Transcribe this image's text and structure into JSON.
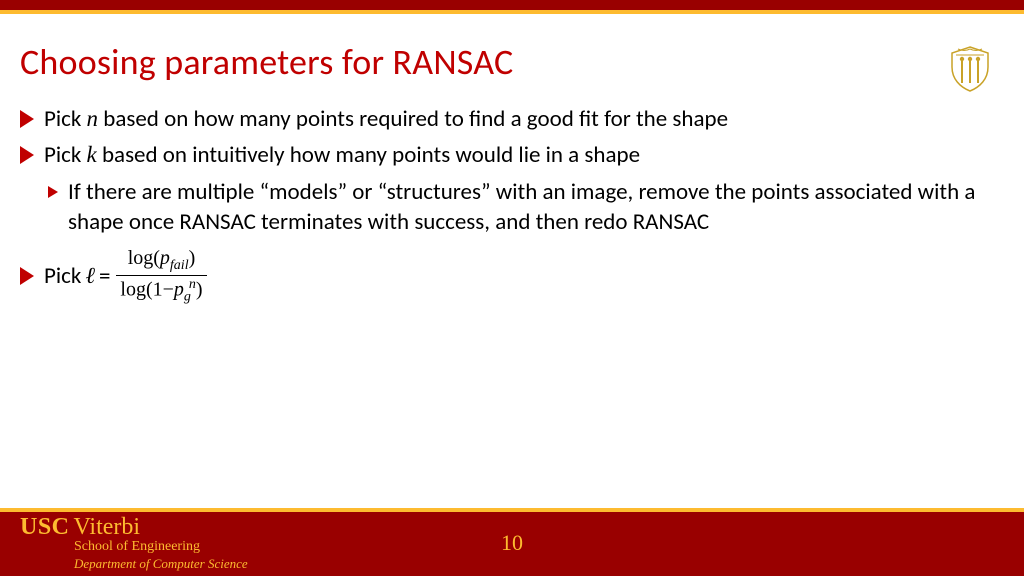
{
  "title": "Choosing parameters for RANSAC",
  "bullets": {
    "b1_pre": "Pick ",
    "b1_var": "n",
    "b1_post": " based on how many points required to find a good fit for the shape",
    "b2_pre": "Pick ",
    "b2_var": "k",
    "b2_post": " based on intuitively how many points would lie in a shape",
    "b2_sub": "If there are multiple “models” or “structures” with an image, remove the points associated with a shape once RANSAC terminates with success, and then redo RANSAC",
    "b3_pre": "Pick ",
    "b3_var": "ℓ",
    "b3_eq": "  = ",
    "frac_num_a": "log(",
    "frac_num_b": "p",
    "frac_num_c": "fail",
    "frac_num_d": ")",
    "frac_den_a": "log(1−",
    "frac_den_b": "p",
    "frac_den_c": "g",
    "frac_den_d": "n",
    "frac_den_e": ")"
  },
  "footer": {
    "usc": "USC",
    "viterbi": "Viterbi",
    "school": "School of Engineering",
    "dept": "Department of  Computer Science",
    "page": "10"
  }
}
